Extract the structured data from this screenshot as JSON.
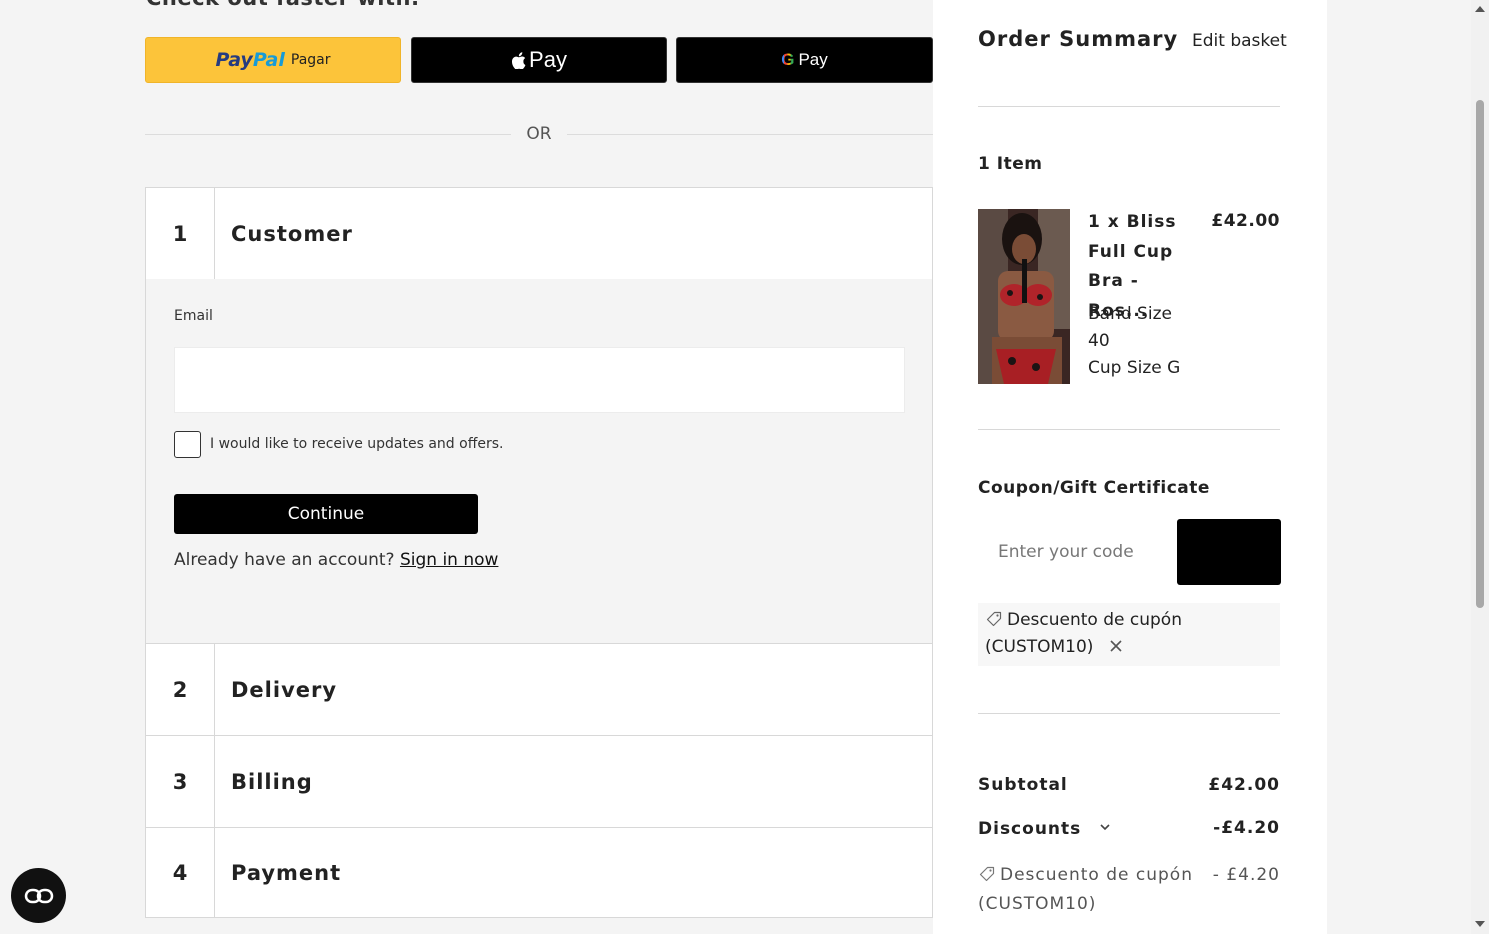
{
  "checkout": {
    "express_heading": "Check out faster with:",
    "paypal": {
      "brand_pay": "Pay",
      "brand_pal": "Pal",
      "action": "Pagar"
    },
    "applepay_label": "Pay",
    "googlepay": {
      "g": "G",
      "label": "Pay"
    },
    "or_separator": "OR",
    "steps": [
      {
        "number": "1",
        "title": "Customer"
      },
      {
        "number": "2",
        "title": "Delivery"
      },
      {
        "number": "3",
        "title": "Billing"
      },
      {
        "number": "4",
        "title": "Payment"
      }
    ],
    "customer": {
      "email_label": "Email",
      "email_value": "",
      "newsletter_label": "I would like to receive updates and offers.",
      "continue_label": "Continue",
      "account_prompt": "Already have an account?",
      "signin_label": "Sign in now"
    }
  },
  "summary": {
    "title": "Order Summary",
    "edit_label": "Edit basket",
    "item_count": "1 Item",
    "item": {
      "name": "1 x Bliss Full Cup Bra - Ros...",
      "price": "£42.00",
      "band_size_label": "Band Size 40",
      "cup_size_label": "Cup Size G"
    },
    "coupon": {
      "title": "Coupon/Gift Certificate",
      "placeholder": "Enter your code here",
      "applied_text": "Descuento de cupón (CUSTOM10)"
    },
    "subtotal_label": "Subtotal",
    "subtotal_value": "£42.00",
    "discounts_label": "Discounts",
    "discounts_value": "-£4.20",
    "discount_line_label": "Descuento de cupón (CUSTOM10)",
    "discount_line_value": "- £4.20"
  },
  "colors": {
    "paypal_yellow": "#fcc43a",
    "black": "#000000",
    "panel_gray": "#f4f4f4"
  }
}
